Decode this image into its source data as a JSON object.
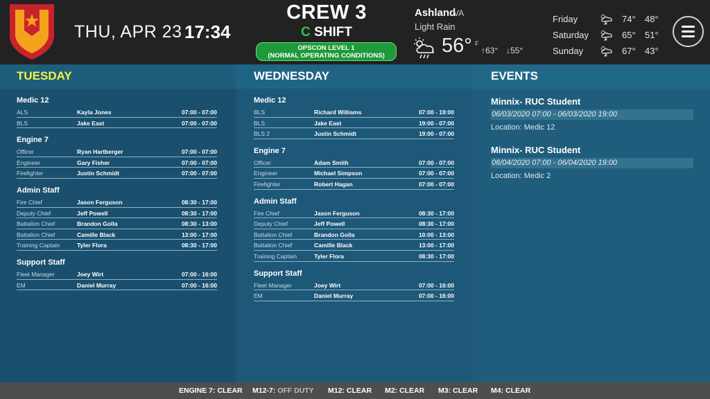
{
  "header": {
    "date": "THU, APR 23",
    "time": "17:34",
    "crew": "CREW 3",
    "shift_letter": "C",
    "shift_word": "SHIFT",
    "opscon_line1": "OPSCON LEVEL 1",
    "opscon_line2": "(NORMAL OPERATING CONDITIONS)",
    "opscon_color": "#1e9a3a"
  },
  "weather": {
    "city": "Ashland",
    "state": "VA",
    "condition": "Light Rain",
    "icon": "rain-cloud-icon",
    "temp": "56°",
    "unit": "F",
    "high": "63°",
    "low": "55°",
    "forecast": [
      {
        "day": "Friday",
        "high": "74°",
        "low": "48°",
        "icon": "storm-cloud-icon"
      },
      {
        "day": "Saturday",
        "high": "65°",
        "low": "51°",
        "icon": "storm-cloud-icon"
      },
      {
        "day": "Sunday",
        "high": "67°",
        "low": "43°",
        "icon": "storm-cloud-icon"
      }
    ]
  },
  "tuesday": {
    "title": "TUESDAY",
    "groups": [
      {
        "name": "Medic 12",
        "rows": [
          {
            "role": "ALS",
            "name": "Kayla Jones",
            "hours": "07:00 - 07:00"
          },
          {
            "role": "BLS",
            "name": "Jake East",
            "hours": "07:00 - 07:00"
          }
        ]
      },
      {
        "name": "Engine 7",
        "rows": [
          {
            "role": "Officer",
            "name": "Ryan Hartberger",
            "hours": "07:00 - 07:00"
          },
          {
            "role": "Engineer",
            "name": "Gary Fisher",
            "hours": "07:00 - 07:00"
          },
          {
            "role": "Firefighter",
            "name": "Justin Schmidt",
            "hours": "07:00 - 07:00"
          }
        ]
      },
      {
        "name": "Admin Staff",
        "rows": [
          {
            "role": "Fire Chief",
            "name": "Jason Ferguson",
            "hours": "08:30 - 17:00"
          },
          {
            "role": "Deputy Chief",
            "name": "Jeff Powell",
            "hours": "08:30 - 17:00"
          },
          {
            "role": "Battalion Chief",
            "name": "Brandon Golla",
            "hours": "08:30 - 13:00"
          },
          {
            "role": "Battalion Chief",
            "name": "Camille Black",
            "hours": "13:00 - 17:00"
          },
          {
            "role": "Training Captain",
            "name": "Tyler Flora",
            "hours": "08:30 - 17:00"
          }
        ]
      },
      {
        "name": "Support Staff",
        "rows": [
          {
            "role": "Fleet Manager",
            "name": "Joey Wirt",
            "hours": "07:00 - 16:00"
          },
          {
            "role": "EM",
            "name": "Daniel Murray",
            "hours": "07:00 - 16:00"
          }
        ]
      }
    ]
  },
  "wednesday": {
    "title": "WEDNESDAY",
    "groups": [
      {
        "name": "Medic 12",
        "rows": [
          {
            "role": "BLS",
            "name": "Richard Williams",
            "hours": "07:00 - 19:00"
          },
          {
            "role": "BLS",
            "name": "Jake East",
            "hours": "19:00 - 07:00"
          },
          {
            "role": "BLS 2",
            "name": "Justin Schmidt",
            "hours": "19:00 - 07:00"
          }
        ]
      },
      {
        "name": "Engine 7",
        "rows": [
          {
            "role": "Officer",
            "name": "Adam Smith",
            "hours": "07:00 - 07:00"
          },
          {
            "role": "Engineer",
            "name": "Michael Simpson",
            "hours": "07:00 - 07:00"
          },
          {
            "role": "Firefighter",
            "name": "Robert Hagan",
            "hours": "07:00 - 07:00"
          }
        ]
      },
      {
        "name": "Admin Staff",
        "rows": [
          {
            "role": "Fire Chief",
            "name": "Jason Ferguson",
            "hours": "08:30 - 17:00"
          },
          {
            "role": "Deputy Chief",
            "name": "Jeff Powell",
            "hours": "08:30 - 17:00"
          },
          {
            "role": "Battalion Chief",
            "name": "Brandon Golla",
            "hours": "10:00 - 13:00"
          },
          {
            "role": "Battalion Chief",
            "name": "Camille Black",
            "hours": "13:00 - 17:00"
          },
          {
            "role": "Training Captain",
            "name": "Tyler Flora",
            "hours": "08:30 - 17:00"
          }
        ]
      },
      {
        "name": "Support Staff",
        "rows": [
          {
            "role": "Fleet Manager",
            "name": "Joey Wirt",
            "hours": "07:00 - 16:00"
          },
          {
            "role": "EM",
            "name": "Daniel Murray",
            "hours": "07:00 - 16:00"
          }
        ]
      }
    ]
  },
  "events": {
    "title": "EVENTS",
    "items": [
      {
        "title": "Minnix- RUC Student",
        "dates": "06/03/2020 07:00 - 06/03/2020 19:00",
        "location": "Location: Medic 12"
      },
      {
        "title": "Minnix- RUC Student",
        "dates": "06/04/2020 07:00 - 06/04/2020 19:00",
        "location": "Location: Medic 2"
      }
    ]
  },
  "status_bar": [
    {
      "unit": "ENGINE 7:",
      "state": "CLEAR",
      "off": false
    },
    {
      "unit": "M12-7:",
      "state": "OFF DUTY",
      "off": true
    },
    {
      "unit": "M12:",
      "state": "CLEAR",
      "off": false
    },
    {
      "unit": "M2:",
      "state": "CLEAR",
      "off": false
    },
    {
      "unit": "M3:",
      "state": "CLEAR",
      "off": false
    },
    {
      "unit": "M4:",
      "state": "CLEAR",
      "off": false
    }
  ]
}
